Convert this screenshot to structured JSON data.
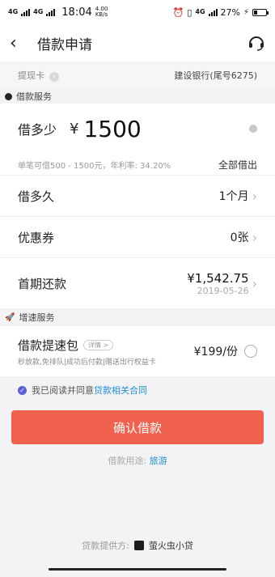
{
  "status_bar": {
    "network_left": "4G",
    "network_right": "4G",
    "speed": "4.00",
    "speed_unit": "KB/s",
    "time": "18:04",
    "battery": "27%"
  },
  "nav": {
    "title": "借款申请"
  },
  "withdraw": {
    "label": "提现卡",
    "bank": "建设银行(尾号6275)"
  },
  "sections": {
    "loan": "借款服务",
    "boost": "增速服务"
  },
  "amount": {
    "label": "借多少",
    "currency": "¥",
    "value": "1500",
    "range_text": "单笔可借500 - 1500元，年利率: 34.20%",
    "all_label": "全部借出"
  },
  "term": {
    "label": "借多久",
    "value": "1个月"
  },
  "coupon": {
    "label": "优惠券",
    "value": "0张"
  },
  "repayment": {
    "label": "首期还款",
    "amount": "¥1,542.75",
    "date": "2019-05-26"
  },
  "boost": {
    "title": "借款提速包",
    "tag": "详情 >",
    "desc": "秒放款,免排队|成功后付款|赠送出行权益卡",
    "price": "¥199/份"
  },
  "agreement": {
    "text": "我已阅读并同意",
    "link": "贷款相关合同"
  },
  "confirm": {
    "label": "确认借款"
  },
  "purpose": {
    "label": "借款用途:",
    "value": "旅游"
  },
  "provider": {
    "label": "贷款提供方:",
    "name": "萤火虫小贷"
  }
}
